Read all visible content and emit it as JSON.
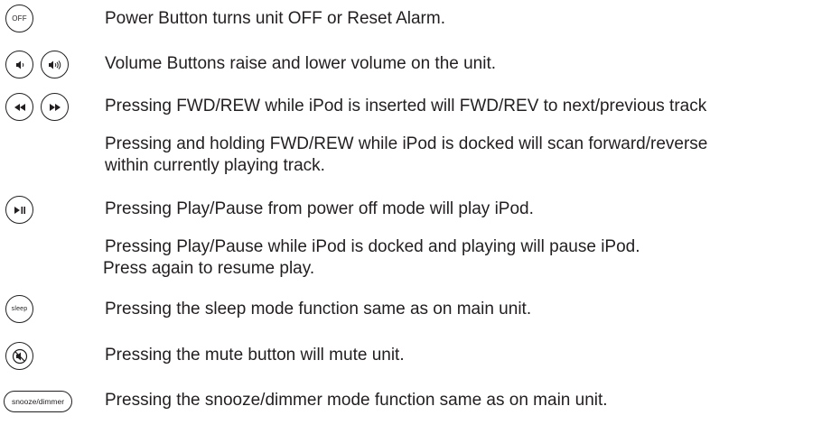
{
  "rows": [
    {
      "icons": [
        {
          "name": "power-off-button-icon",
          "label": "OFF"
        }
      ],
      "lines": [
        "Power Button turns unit OFF or Reset Alarm."
      ]
    },
    {
      "icons": [
        {
          "name": "volume-down-button-icon"
        },
        {
          "name": "volume-up-button-icon"
        }
      ],
      "lines": [
        "Volume Buttons raise and lower volume on the unit."
      ]
    },
    {
      "icons": [
        {
          "name": "rewind-button-icon"
        },
        {
          "name": "fast-forward-button-icon"
        }
      ],
      "lines": [
        "Pressing FWD/REW while iPod is inserted will FWD/REV to next/previous track"
      ]
    },
    {
      "icons": [],
      "lines": [
        "Pressing and holding FWD/REW while iPod is docked will scan forward/reverse",
        "within currently playing track."
      ]
    },
    {
      "icons": [
        {
          "name": "play-pause-button-icon"
        }
      ],
      "lines": [
        "Pressing Play/Pause from power off mode will play iPod."
      ]
    },
    {
      "icons": [],
      "lines": [
        "Pressing Play/Pause while iPod is docked and playing will pause iPod.",
        "Press again to resume play."
      ]
    },
    {
      "icons": [
        {
          "name": "sleep-button-icon",
          "label": "sleep"
        }
      ],
      "lines": [
        "Pressing the sleep mode function same as on main unit."
      ]
    },
    {
      "icons": [
        {
          "name": "mute-button-icon"
        }
      ],
      "lines": [
        "Pressing the mute button will mute unit."
      ]
    },
    {
      "icons": [
        {
          "name": "snooze-dimmer-button-icon",
          "label": "snooze/dimmer"
        }
      ],
      "lines": [
        "Pressing the snooze/dimmer mode function same as on main unit."
      ]
    }
  ]
}
